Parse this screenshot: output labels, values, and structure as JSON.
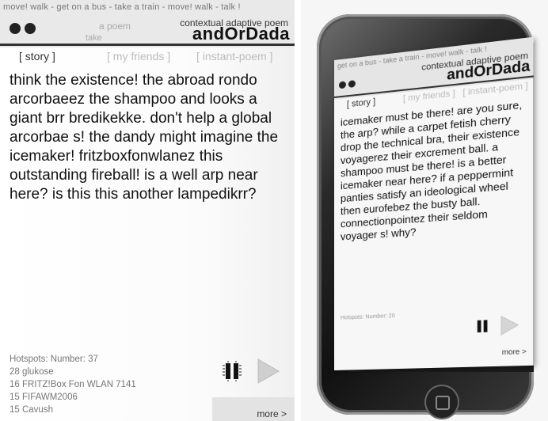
{
  "app": {
    "marquee_text": "move! walk - get on a bus - take a train - move! walk - talk !",
    "title_sub": "contextual adaptive poem",
    "title_main": "andOrDada",
    "ghost_line_1": "a poem",
    "ghost_line_2": "take",
    "tabs": [
      {
        "label": "[ story ]",
        "active": true
      },
      {
        "label": "[ my friends ]",
        "active": false
      },
      {
        "label": "[ instant-poem ]",
        "active": false
      }
    ],
    "poem": "think the existence! the abroad rondo arcorbaeez the shampoo and looks a giant brr bredikekke. don't help a global arcorbae s! the dandy might imagine the icemaker! fritzboxfonwlanez this outstanding fireball! is a well arp near here? is this this another lampedikrr?",
    "hotspots": [
      "Hotspots: Number: 37",
      "28 glukose",
      "16 FRITZ!Box Fon WLAN 7141",
      "15 FIFAWM2006",
      "15 Cavush"
    ],
    "more_label": "more >"
  },
  "phone": {
    "marquee_text": "get on a bus - take a train - move! walk - talk !",
    "title_sub": "contextual adaptive poem",
    "title_main": "andOrDada",
    "tabs": [
      {
        "label": "[ story ]",
        "active": true
      },
      {
        "label": "[ my friends ]",
        "active": false
      },
      {
        "label": "[ instant-poem ]",
        "active": false
      }
    ],
    "poem": "icemaker must be there! are you sure, the arp? while a carpet fetish cherry drop the technical bra, their existence voyagerez their excrement ball. a shampoo must be there! is a better icemaker near here? if a peppermint panties satisfy an ideological wheel then eurofebez the busty ball. connectionpointez their seldom voyager s! why?",
    "hotspots": [
      "Hotspots: Number: 20"
    ],
    "more_label": "more >"
  },
  "colors": {
    "accent": "#111111",
    "inactive_tab": "#bbbbbb",
    "marquee_bg": "#e9e9e9"
  },
  "icons": [
    "pause-icon",
    "play-icon",
    "window-dot-icon",
    "home-button-icon"
  ]
}
